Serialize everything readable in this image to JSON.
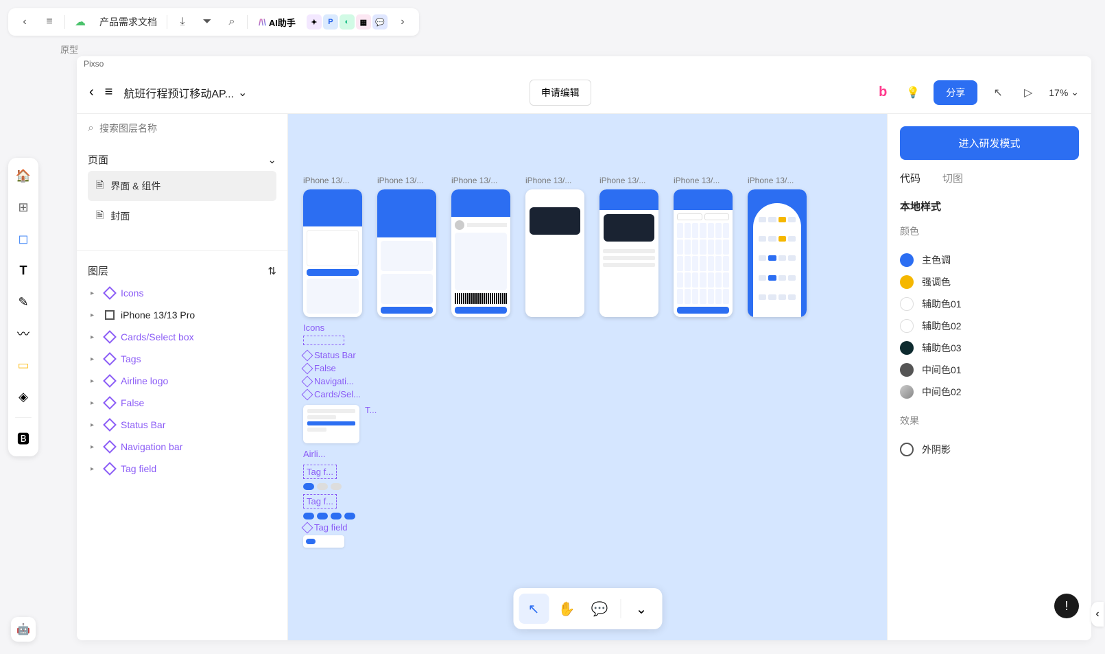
{
  "outer": {
    "doc_title": "产品需求文档",
    "ai_label": "AI助手",
    "ai_badges": [
      "",
      "P",
      "",
      "",
      ""
    ]
  },
  "proto_label": "原型",
  "design_window_title": "Pixso",
  "header": {
    "file_name": "航班行程预订移动AP...",
    "edit_btn": "申请编辑",
    "share_btn": "分享",
    "zoom": "17%"
  },
  "left_panel": {
    "search_placeholder": "搜索图层名称",
    "pages_title": "页面",
    "pages": [
      "界面 & 组件",
      "封面"
    ],
    "layers_title": "图层",
    "layers": [
      {
        "name": "Icons",
        "type": "component"
      },
      {
        "name": "iPhone 13/13 Pro",
        "type": "frame"
      },
      {
        "name": "Cards/Select box",
        "type": "component"
      },
      {
        "name": "Tags",
        "type": "component"
      },
      {
        "name": "Airline logo",
        "type": "component"
      },
      {
        "name": "False",
        "type": "component"
      },
      {
        "name": "Status Bar",
        "type": "component"
      },
      {
        "name": "Navigation bar",
        "type": "component"
      },
      {
        "name": "Tag field",
        "type": "component"
      }
    ]
  },
  "canvas": {
    "artboards": [
      "iPhone 13/...",
      "iPhone 13/...",
      "iPhone 13/...",
      "iPhone 13/...",
      "iPhone 13/...",
      "iPhone 13/...",
      "iPhone 13/..."
    ],
    "comp_icons": "Icons",
    "comp_status": "Status Bar",
    "comp_false": "False",
    "comp_nav": "Navigati...",
    "comp_cards": "Cards/Sel...",
    "comp_t": "T...",
    "comp_airline": "Airli...",
    "comp_tagf1": "Tag f...",
    "comp_tagf2": "Tag f...",
    "comp_tagfield": "Tag field"
  },
  "right_panel": {
    "dev_btn": "进入研发模式",
    "tabs": [
      "代码",
      "切图"
    ],
    "local_styles": "本地样式",
    "colors_title": "颜色",
    "colors": [
      {
        "name": "主色调",
        "hex": "#2c6ef2"
      },
      {
        "name": "强调色",
        "hex": "#f5b700"
      },
      {
        "name": "辅助色01",
        "hex": "#ffffff",
        "border": true
      },
      {
        "name": "辅助色02",
        "hex": "#ffffff",
        "border": true
      },
      {
        "name": "辅助色03",
        "hex": "#0d2a2e"
      },
      {
        "name": "中间色01",
        "hex": "#555555"
      },
      {
        "name": "中间色02",
        "hex": "#cccccc",
        "grad": true
      }
    ],
    "effects_title": "效果",
    "effects": [
      "外阴影"
    ]
  }
}
